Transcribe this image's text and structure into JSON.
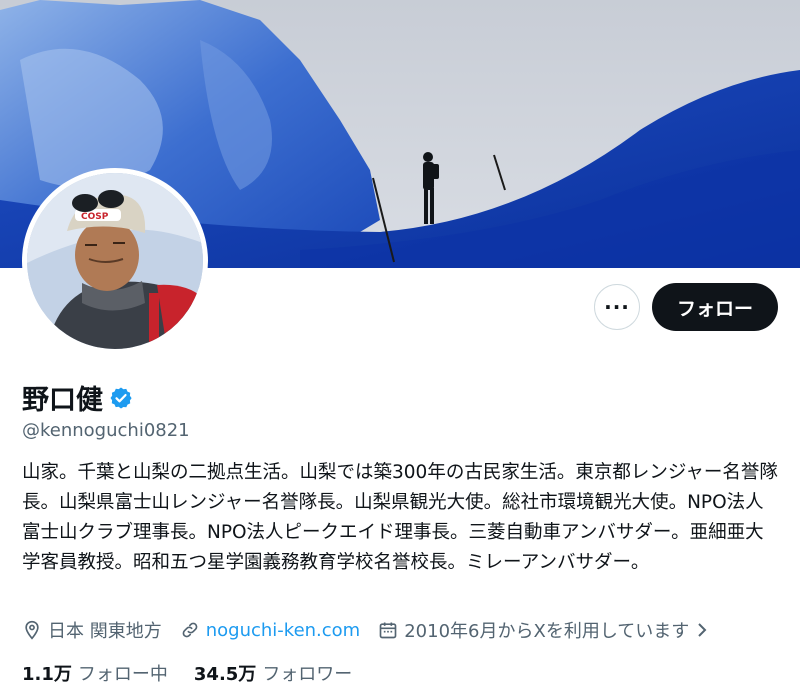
{
  "profile": {
    "name": "野口健",
    "handle": "@kennoguchi0821",
    "bio": "山家。千葉と山梨の二拠点生活。山梨では築300年の古民家生活。東京都レンジャー名誉隊長。山梨県富士山レンジャー名誉隊長。山梨県観光大使。総社市環境観光大使。NPO法人富士山クラブ理事長。NPO法人ピークエイド理事長。三菱自動車アンバサダー。亜細亜大学客員教授。昭和五つ星学園義務教育学校名誉校長。ミレーアンバサダー。",
    "verified": true
  },
  "actions": {
    "more_label": "···",
    "follow_label": "フォロー"
  },
  "meta": {
    "location": "日本 関東地方",
    "website": "noguchi-ken.com",
    "joined": "2010年6月からXを利用しています"
  },
  "stats": {
    "following_count": "1.1万",
    "following_label": "フォロー中",
    "followers_count": "34.5万",
    "followers_label": "フォロワー"
  },
  "icons": {
    "verified": "verified-badge-icon",
    "location": "location-pin-icon",
    "link": "link-icon",
    "calendar": "calendar-icon",
    "chevron": "chevron-right-icon"
  },
  "colors": {
    "verified_blue": "#1d9bf0",
    "link_blue": "#1d9bf0",
    "follow_bg": "#0f1419",
    "secondary_text": "#536471"
  }
}
